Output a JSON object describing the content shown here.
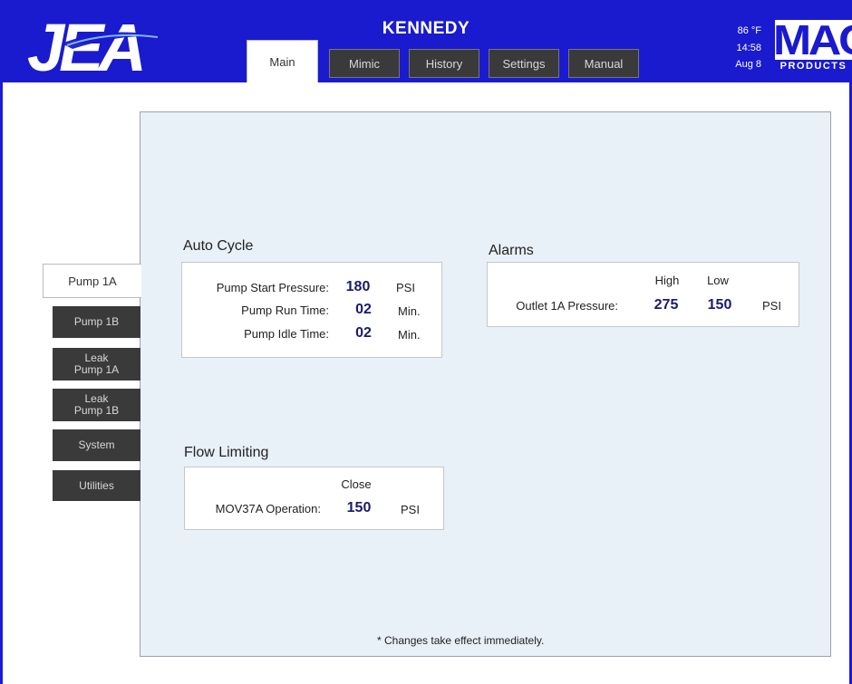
{
  "header": {
    "station": "KENNEDY",
    "tabs": [
      "Main",
      "Mimic",
      "History",
      "Settings",
      "Manual"
    ],
    "active_tab": "Main",
    "temperature": "86 °F",
    "time": "14:58",
    "date": "Aug 8",
    "logo_left": "JEA",
    "logo_right_main": "MAC",
    "logo_right_sub": "PRODUCTS"
  },
  "sidebar": {
    "items": [
      "Pump 1A",
      "Pump 1B",
      "Leak\nPump 1A",
      "Leak\nPump 1B",
      "System",
      "Utilities"
    ],
    "active": "Pump 1A"
  },
  "auto_cycle": {
    "title": "Auto Cycle",
    "rows": [
      {
        "label": "Pump Start Pressure:",
        "value": "180",
        "unit": "PSI"
      },
      {
        "label": "Pump Run Time:",
        "value": "02",
        "unit": "Min."
      },
      {
        "label": "Pump Idle Time:",
        "value": "02",
        "unit": "Min."
      }
    ]
  },
  "alarms": {
    "title": "Alarms",
    "col_high": "High",
    "col_low": "Low",
    "row": {
      "label": "Outlet 1A Pressure:",
      "high": "275",
      "low": "150",
      "unit": "PSI"
    }
  },
  "flow_limiting": {
    "title": "Flow Limiting",
    "col_close": "Close",
    "row": {
      "label": "MOV37A Operation:",
      "value": "150",
      "unit": "PSI"
    }
  },
  "footer_note": "* Changes take effect immediately.",
  "colors": {
    "header_blue": "#1a1acf",
    "panel_bg": "#e8f0f8",
    "button_dark": "#3a3a3a",
    "value_text": "#1a1a6e"
  }
}
